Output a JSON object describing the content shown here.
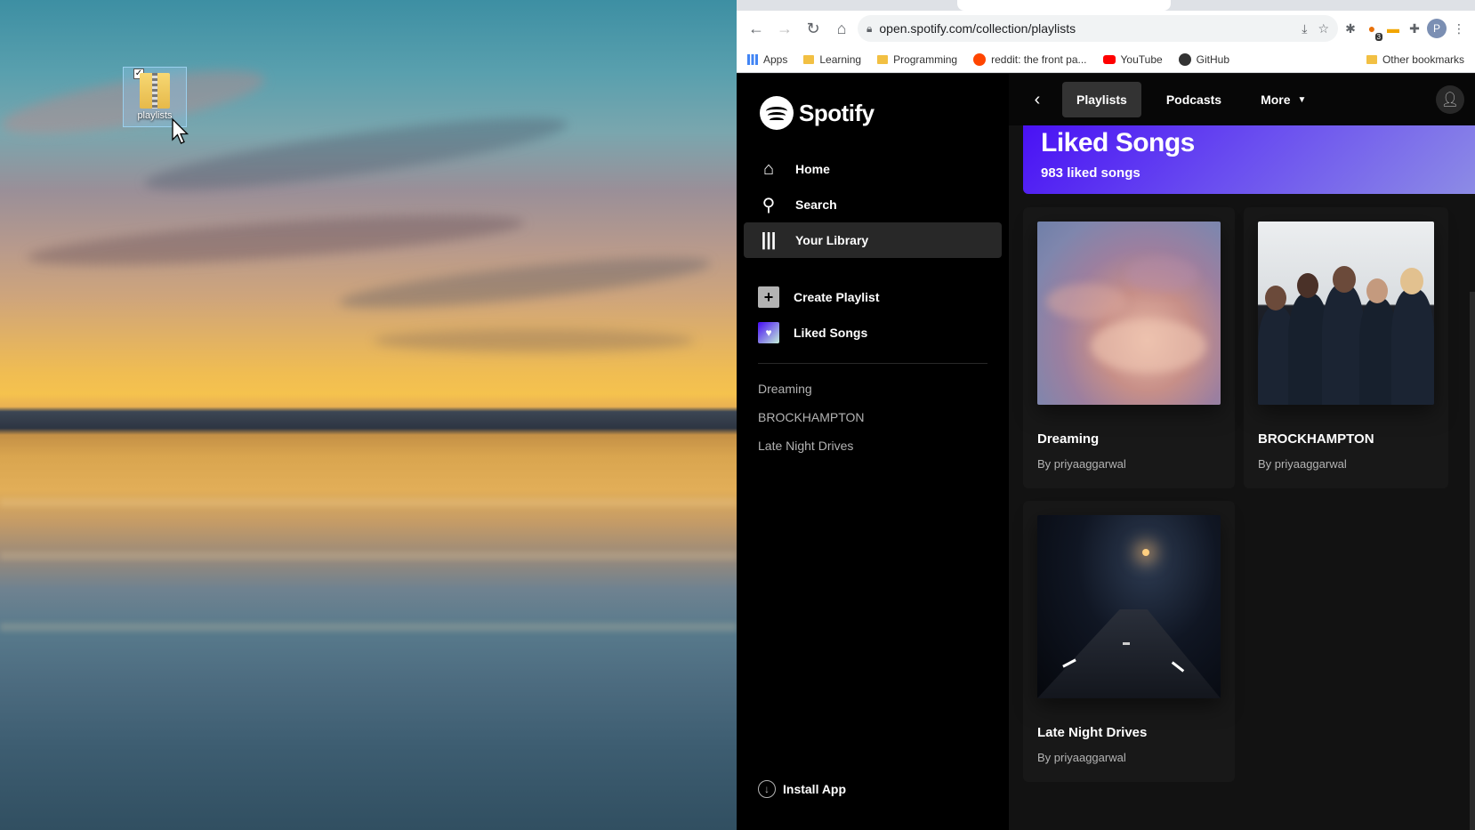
{
  "desktop": {
    "icon_label": "playlists"
  },
  "browser": {
    "url": "open.spotify.com/collection/playlists",
    "bookmarks": [
      {
        "label": "Apps"
      },
      {
        "label": "Learning"
      },
      {
        "label": "Programming"
      },
      {
        "label": "reddit: the front pa..."
      },
      {
        "label": "YouTube"
      },
      {
        "label": "GitHub"
      }
    ],
    "other_bookmarks": "Other bookmarks",
    "profile_initial": "P",
    "ext_badge": "3"
  },
  "spotify": {
    "brand": "Spotify",
    "nav": [
      {
        "label": "Home",
        "icon": "home-icon"
      },
      {
        "label": "Search",
        "icon": "search-icon"
      },
      {
        "label": "Your Library",
        "icon": "library-icon",
        "active": true
      }
    ],
    "actions": {
      "create_playlist": "Create Playlist",
      "liked_songs": "Liked Songs"
    },
    "sidebar_playlists": [
      "Dreaming",
      "BROCKHAMPTON",
      "Late Night Drives"
    ],
    "install_app": "Install App",
    "top_tabs": {
      "playlists": "Playlists",
      "podcasts": "Podcasts",
      "more": "More"
    },
    "liked_banner": {
      "title": "Liked Songs",
      "subtitle": "983 liked songs"
    },
    "cards": [
      {
        "name": "Dreaming",
        "by": "By priyaaggarwal"
      },
      {
        "name": "BROCKHAMPTON",
        "by": "By priyaaggarwal"
      },
      {
        "name": "Late Night Drives",
        "by": "By priyaaggarwal"
      }
    ]
  },
  "colors": {
    "spotify_black": "#000000",
    "surface": "#121212",
    "card": "#181818",
    "liked_gradient_start": "#450af5"
  }
}
